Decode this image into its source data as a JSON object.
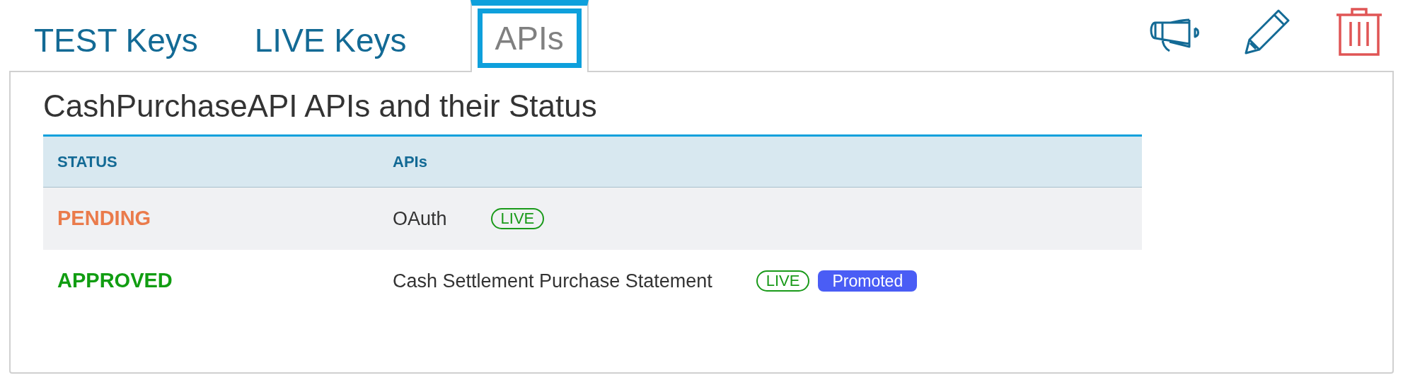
{
  "tabs": [
    {
      "label": "TEST Keys",
      "selected": false
    },
    {
      "label": "LIVE Keys",
      "selected": false
    },
    {
      "label": "APIs",
      "selected": true
    }
  ],
  "panel": {
    "title": "CashPurchaseAPI APIs and their Status",
    "table": {
      "columns": [
        "STATUS",
        "APIs"
      ],
      "rows": [
        {
          "status": "PENDING",
          "color": "#ea7b4b",
          "api": "OAuth",
          "badges": [
            {
              "kind": "live",
              "label": "LIVE"
            }
          ]
        },
        {
          "status": "APPROVED",
          "color": "#119d12",
          "api": "Cash Settlement Purchase Statement",
          "badges": [
            {
              "kind": "live",
              "label": "LIVE"
            },
            {
              "kind": "promoted",
              "label": "Promoted"
            }
          ]
        }
      ]
    }
  }
}
